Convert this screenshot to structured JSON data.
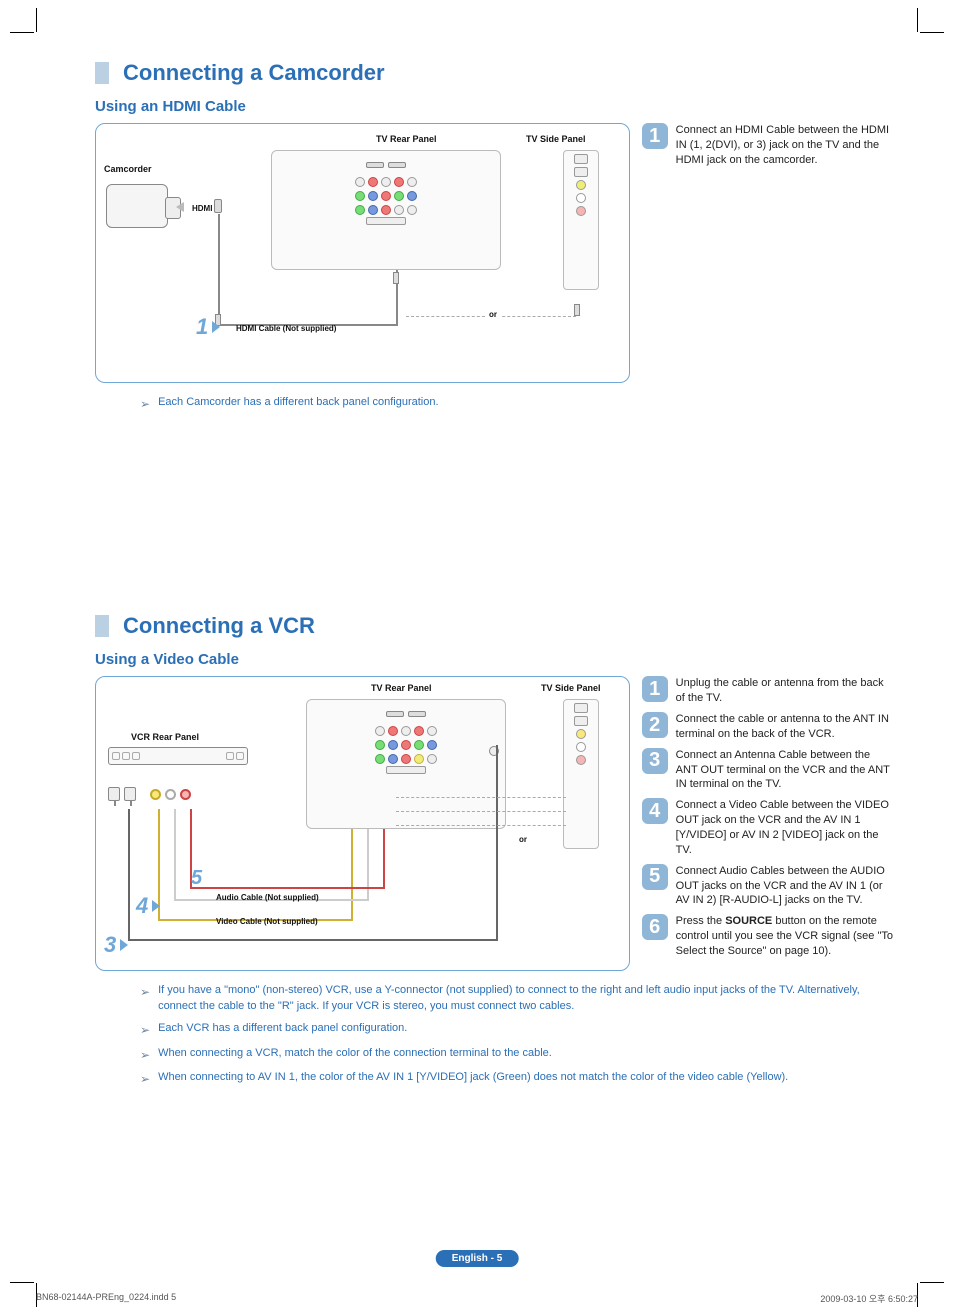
{
  "section1": {
    "title": "Connecting a Camcorder",
    "subheading": "Using an HDMI Cable",
    "labels": {
      "tv_rear": "TV Rear Panel",
      "tv_side": "TV Side Panel",
      "camcorder": "Camcorder",
      "hdmi": "HDMI",
      "cable": "HDMI Cable (Not supplied)",
      "or": "or"
    },
    "diagram_numbers": [
      "1"
    ],
    "steps": [
      {
        "n": "1",
        "text_html": "Connect an HDMI Cable between the HDMI IN (1, 2(DVI), or 3) jack on the TV and the HDMI jack on the camcorder."
      }
    ],
    "notes": [
      "Each Camcorder has a different back panel configuration."
    ]
  },
  "section2": {
    "title": "Connecting a VCR",
    "subheading": "Using a Video Cable",
    "labels": {
      "tv_rear": "TV Rear Panel",
      "tv_side": "TV Side Panel",
      "vcr_rear": "VCR Rear Panel",
      "audio_cable": "Audio Cable (Not supplied)",
      "video_cable": "Video Cable (Not supplied)",
      "or": "or"
    },
    "diagram_numbers": [
      "3",
      "4",
      "5"
    ],
    "steps": [
      {
        "n": "1",
        "text_html": "Unplug the cable or antenna from the back of the TV."
      },
      {
        "n": "2",
        "text_html": "Connect the cable or antenna to the ANT IN terminal on the back of the VCR."
      },
      {
        "n": "3",
        "text_html": "Connect an Antenna Cable between the ANT OUT terminal on the VCR and the ANT IN terminal on the TV."
      },
      {
        "n": "4",
        "text_html": "Connect a Video Cable between the VIDEO OUT jack on the VCR and the AV IN 1 [Y/VIDEO] or AV IN 2 [VIDEO] jack on the TV."
      },
      {
        "n": "5",
        "text_html": "Connect Audio Cables between the AUDIO OUT jacks on the VCR and the AV IN 1 (or AV IN 2) [R-AUDIO-L] jacks on the TV."
      },
      {
        "n": "6",
        "text_html": "Press the <b>SOURCE</b> button on the remote control until you see the VCR signal (see \"To Select the Source\" on page 10)."
      }
    ],
    "notes": [
      "If you have a \"mono\" (non-stereo) VCR, use a Y-connector (not supplied) to connect to the right and left audio input jacks of the TV. Alternatively, connect the cable to the \"R\" jack. If your VCR is stereo, you must connect two cables.",
      "Each VCR has a different back panel configuration.",
      "When connecting a VCR, match the color of the connection terminal to the cable.",
      "When connecting to AV IN 1, the color of the AV IN 1 [Y/VIDEO] jack (Green) does not match the color of the video cable (Yellow)."
    ]
  },
  "footer": {
    "label": "English - 5"
  },
  "print": {
    "file": "BN68-02144A-PREng_0224.indd   5",
    "timestamp": "2009-03-10   오후 6:50:27"
  }
}
